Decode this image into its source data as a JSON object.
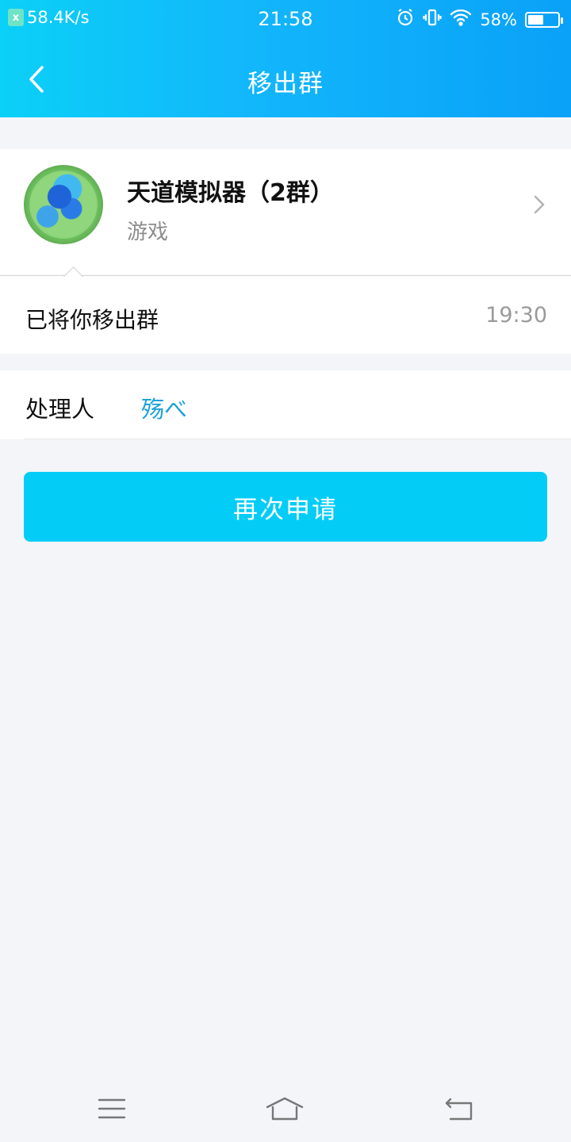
{
  "status_bar": {
    "net_badge": "x",
    "net_speed": "58.4K/s",
    "time": "21:58",
    "battery_text": "58%",
    "battery_level": 0.58,
    "icons": [
      "alarm-icon",
      "vibrate-icon",
      "wifi-icon",
      "battery-icon"
    ]
  },
  "header": {
    "title": "移出群",
    "back_icon": "chevron-left-icon"
  },
  "group": {
    "name": "天道模拟器（2群）",
    "category": "游戏",
    "chevron_icon": "chevron-right-icon"
  },
  "notice": {
    "text": "已将你移出群",
    "time": "19:30"
  },
  "handler": {
    "label": "处理人",
    "name": "殇べ"
  },
  "actions": {
    "reapply_label": "再次申请"
  },
  "nav_bar": {
    "icons": [
      "menu-icon",
      "home-icon",
      "back-icon"
    ]
  },
  "colors": {
    "header_gradient_start": "#0bd0f7",
    "header_gradient_end": "#0aa1f8",
    "button": "#03cdf7",
    "handler_link": "#1aa2d8",
    "background": "#f3f5f9"
  }
}
